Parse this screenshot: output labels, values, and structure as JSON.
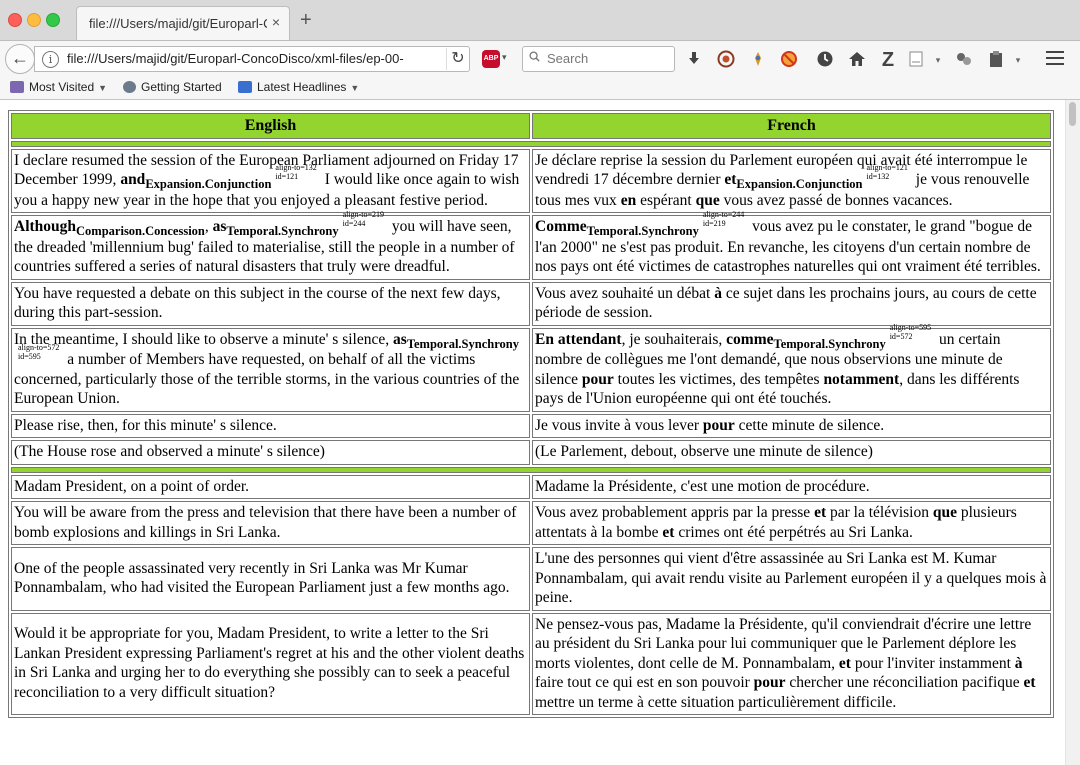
{
  "browser": {
    "tab_title": "file:///Users/majid/git/Europarl-Co",
    "tab_close": "×",
    "new_tab": "+",
    "url": "file:///Users/majid/git/Europarl-ConcoDisco/xml-files/ep-00-",
    "info_glyph": "i",
    "back_glyph": "←",
    "reload_glyph": "↻",
    "abp_label": "ABP",
    "search_placeholder": "Search",
    "toolbar_icons": [
      "download-icon",
      "extension-icon",
      "extension-icon",
      "blocked-icon",
      "history-icon",
      "home-icon",
      "zotero-icon",
      "reader-icon",
      "extension-icon",
      "clipboard-icon"
    ]
  },
  "bookmarks": [
    {
      "label": "Most Visited",
      "dropdown": true
    },
    {
      "label": "Getting Started",
      "dropdown": false
    },
    {
      "label": "Latest Headlines",
      "dropdown": true
    }
  ],
  "table": {
    "headers": [
      "English",
      "French"
    ],
    "rows": [
      {
        "type": "pair",
        "en": [
          {
            "t": "I declare resumed the session of the European Parliament adjourned on Friday 17 December 1999, "
          },
          {
            "m": "and",
            "rel": "Expansion.Conjunction",
            "align_to": "align-to=132",
            "id": "id=121"
          },
          {
            "t": " I would like once again to wish you a happy new year in the hope that you enjoyed a pleasant festive period."
          }
        ],
        "fr": [
          {
            "t": "Je déclare reprise la session du Parlement européen qui avait été interrompue le vendredi 17 décembre dernier "
          },
          {
            "m": "et",
            "rel": "Expansion.Conjunction",
            "align_to": "align-to=121",
            "id": "id=132"
          },
          {
            "t": " je vous renouvelle tous mes vux "
          },
          {
            "b": "en"
          },
          {
            "t": " espérant "
          },
          {
            "b": "que"
          },
          {
            "t": " vous avez passé de bonnes vacances."
          }
        ]
      },
      {
        "type": "pair",
        "en": [
          {
            "m": "Although",
            "rel": "Comparison.Concession"
          },
          {
            "t": ", "
          },
          {
            "m": "as",
            "rel": "Temporal.Synchrony",
            "align_to": "align-to=219",
            "id": "id=244"
          },
          {
            "t": " you will have seen, the dreaded 'millennium bug' failed to materialise, still the people in a number of countries suffered a series of natural disasters that truly were dreadful."
          }
        ],
        "fr": [
          {
            "m": "Comme",
            "rel": "Temporal.Synchrony",
            "align_to": "align-to=244",
            "id": "id=219"
          },
          {
            "t": " vous avez pu le constater, le grand \"bogue de l'an 2000\" ne s'est pas produit. En revanche, les citoyens d'un certain nombre de nos pays ont été victimes de catastrophes naturelles qui ont vraiment été terribles."
          }
        ]
      },
      {
        "type": "pair",
        "en": [
          {
            "t": "You have requested a debate on this subject in the course of the next few days, during this part-session."
          }
        ],
        "fr": [
          {
            "t": "Vous avez souhaité un débat "
          },
          {
            "b": "à"
          },
          {
            "t": " ce sujet dans les prochains jours, au cours de cette période de session."
          }
        ]
      },
      {
        "type": "pair",
        "en": [
          {
            "t": "In the meantime, I should like to observe a minute' s silence, "
          },
          {
            "m": "as",
            "rel": "Temporal.Synchrony",
            "align_to": "align-to=572",
            "id": "id=595"
          },
          {
            "t": " a number of Members have requested, on behalf of all the victims concerned, particularly those of the terrible storms, in the various countries of the European Union."
          }
        ],
        "fr": [
          {
            "b": "En attendant"
          },
          {
            "t": ", je souhaiterais, "
          },
          {
            "m": "comme",
            "rel": "Temporal.Synchrony",
            "align_to": "align-to=595",
            "id": "id=572"
          },
          {
            "t": " un certain nombre de collègues me l'ont demandé, que nous observions une minute de silence "
          },
          {
            "b": "pour"
          },
          {
            "t": " toutes les victimes, des tempêtes "
          },
          {
            "b": "notamment"
          },
          {
            "t": ", dans les différents pays de l'Union européenne qui ont été touchés."
          }
        ]
      },
      {
        "type": "pair",
        "en": [
          {
            "t": "Please rise, then, for this minute' s silence."
          }
        ],
        "fr": [
          {
            "t": "Je vous invite à vous lever "
          },
          {
            "b": "pour"
          },
          {
            "t": " cette minute de silence."
          }
        ]
      },
      {
        "type": "pair",
        "en": [
          {
            "t": "(The House rose and observed a minute' s silence)"
          }
        ],
        "fr": [
          {
            "t": "(Le Parlement, debout, observe une minute de silence)"
          }
        ]
      },
      {
        "type": "separator"
      },
      {
        "type": "pair",
        "en": [
          {
            "t": "Madam President, on a point of order."
          }
        ],
        "fr": [
          {
            "t": "Madame la Présidente, c'est une motion de procédure."
          }
        ]
      },
      {
        "type": "pair",
        "en": [
          {
            "t": "You will be aware from the press and television that there have been a number of bomb explosions and killings in Sri Lanka."
          }
        ],
        "fr": [
          {
            "t": "Vous avez probablement appris par la presse "
          },
          {
            "b": "et"
          },
          {
            "t": " par la télévision "
          },
          {
            "b": "que"
          },
          {
            "t": " plusieurs attentats à la bombe "
          },
          {
            "b": "et"
          },
          {
            "t": " crimes ont été perpétrés au Sri Lanka."
          }
        ]
      },
      {
        "type": "pair",
        "en": [
          {
            "t": "One of the people assassinated very recently in Sri Lanka was Mr Kumar Ponnambalam, who had visited the European Parliament just a few months ago."
          }
        ],
        "fr": [
          {
            "t": "L'une des personnes qui vient d'être assassinée au Sri Lanka est M. Kumar Ponnambalam, qui avait rendu visite au Parlement européen il y a quelques mois à peine."
          }
        ]
      },
      {
        "type": "pair",
        "en": [
          {
            "t": "Would it be appropriate for you, Madam President, to write a letter to the Sri Lankan President expressing Parliament's regret at his and the other violent deaths in Sri Lanka and urging her to do everything she possibly can to seek a peaceful reconciliation to a very difficult situation?"
          }
        ],
        "fr": [
          {
            "t": "Ne pensez-vous pas, Madame la Présidente, qu'il conviendrait d'écrire une lettre au président du Sri Lanka pour lui communiquer que le Parlement déplore les morts violentes, dont celle de M. Ponnambalam, "
          },
          {
            "b": "et"
          },
          {
            "t": " pour l'inviter instamment "
          },
          {
            "b": "à"
          },
          {
            "t": " faire tout ce qui est en son pouvoir "
          },
          {
            "b": "pour"
          },
          {
            "t": " chercher une réconciliation pacifique "
          },
          {
            "b": "et"
          },
          {
            "t": " mettre un terme à cette situation particulièrement difficile."
          }
        ]
      }
    ]
  },
  "colors": {
    "header_green": "#93d42f",
    "abp_red": "#c70d2c"
  }
}
